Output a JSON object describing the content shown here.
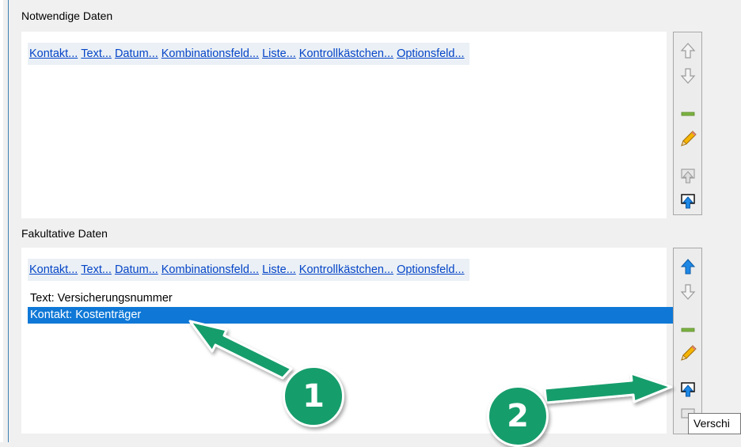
{
  "required": {
    "label": "Notwendige Daten",
    "links": [
      "Kontakt...",
      "Text...",
      "Datum...",
      "Kombinationsfeld...",
      "Liste...",
      "Kontrollkästchen...",
      "Optionsfeld..."
    ],
    "fields": []
  },
  "optional": {
    "label": "Fakultative Daten",
    "links": [
      "Kontakt...",
      "Text...",
      "Datum...",
      "Kombinationsfeld...",
      "Liste...",
      "Kontrollkästchen...",
      "Optionsfeld..."
    ],
    "fields": [
      {
        "text": "Text: Versicherungsnummer",
        "selected": false
      },
      {
        "text": "Kontakt:  Kostenträger",
        "selected": true
      }
    ]
  },
  "toolbar_icons": [
    "move-up-icon",
    "move-down-icon",
    "remove-icon",
    "edit-icon",
    "move-to-required-icon",
    "move-to-optional-icon"
  ],
  "tooltip": "Verschi",
  "callouts": {
    "badge_1": "1",
    "badge_2": "2"
  },
  "colors": {
    "selection": "#0f78d7",
    "link": "#0645c8",
    "callout": "#169d6c",
    "arrow_up_active": "#1e88e5"
  }
}
